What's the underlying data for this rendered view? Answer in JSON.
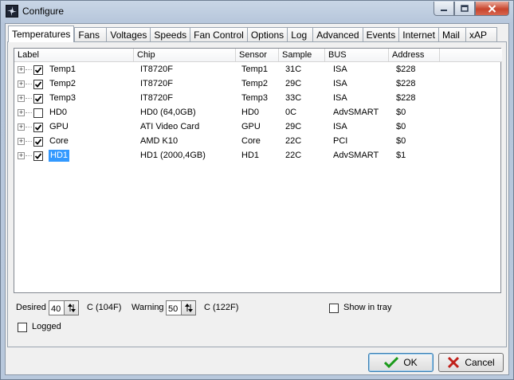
{
  "window": {
    "title": "Configure",
    "icon": "app-fan-icon"
  },
  "tabs": [
    "Temperatures",
    "Fans",
    "Voltages",
    "Speeds",
    "Fan Control",
    "Options",
    "Log",
    "Advanced",
    "Events",
    "Internet",
    "Mail",
    "xAP"
  ],
  "active_tab": "Temperatures",
  "columns": [
    "Label",
    "Chip",
    "Sensor",
    "Sample",
    "BUS",
    "Address"
  ],
  "rows": [
    {
      "checked": true,
      "label": "Temp1",
      "chip": "IT8720F",
      "sensor": "Temp1",
      "sample": "31C",
      "bus": "ISA",
      "address": "$228"
    },
    {
      "checked": true,
      "label": "Temp2",
      "chip": "IT8720F",
      "sensor": "Temp2",
      "sample": "29C",
      "bus": "ISA",
      "address": "$228"
    },
    {
      "checked": true,
      "label": "Temp3",
      "chip": "IT8720F",
      "sensor": "Temp3",
      "sample": "33C",
      "bus": "ISA",
      "address": "$228"
    },
    {
      "checked": false,
      "label": "HD0",
      "chip": "HD0 (64,0GB)",
      "sensor": "HD0",
      "sample": "0C",
      "bus": "AdvSMART",
      "address": "$0"
    },
    {
      "checked": true,
      "label": "GPU",
      "chip": "ATI Video Card",
      "sensor": "GPU",
      "sample": "29C",
      "bus": "ISA",
      "address": "$0"
    },
    {
      "checked": true,
      "label": "Core",
      "chip": "AMD K10",
      "sensor": "Core",
      "sample": "22C",
      "bus": "PCI",
      "address": "$0"
    },
    {
      "checked": true,
      "label": "HD1",
      "chip": "HD1 (2000,4GB)",
      "sensor": "HD1",
      "sample": "22C",
      "bus": "AdvSMART",
      "address": "$1",
      "selected": true
    }
  ],
  "settings": {
    "desired_label": "Desired",
    "desired_value": "40",
    "desired_unit": "C (104F)",
    "warning_label": "Warning",
    "warning_value": "50",
    "warning_unit": "C (122F)",
    "show_in_tray_label": "Show in tray",
    "show_in_tray_checked": false,
    "logged_label": "Logged",
    "logged_checked": false
  },
  "buttons": {
    "ok": "OK",
    "cancel": "Cancel"
  },
  "colors": {
    "selection": "#3399ff",
    "ok_check": "#1a9a1a",
    "cancel_x": "#c0201a"
  }
}
